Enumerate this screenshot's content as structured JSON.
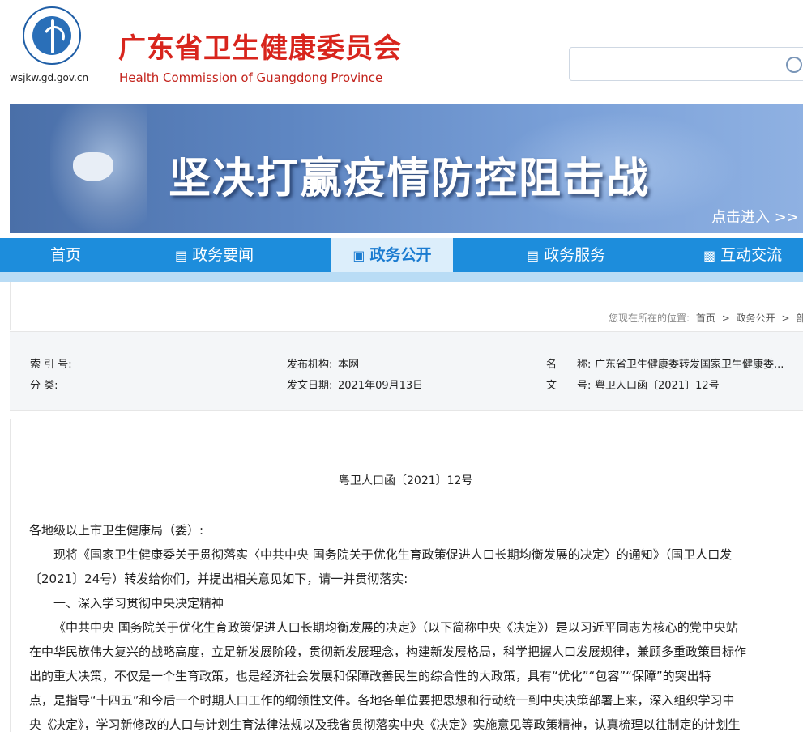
{
  "header": {
    "domain": "wsjkw.gd.gov.cn",
    "title": "广东省卫生健康委员会",
    "subtitle": "Health Commission of Guangdong Province",
    "search_placeholder": ""
  },
  "banner": {
    "title": "坚决打赢疫情防控阻击战",
    "enter_link": "点击进入 >>"
  },
  "nav": {
    "items": [
      {
        "label": "首页",
        "icon": ""
      },
      {
        "label": "政务要闻",
        "icon": "list-icon"
      },
      {
        "label": "政务公开",
        "icon": "book-icon"
      },
      {
        "label": "政务服务",
        "icon": "document-icon"
      },
      {
        "label": "互动交流",
        "icon": "chat-icon"
      }
    ],
    "active": "政务公开"
  },
  "breadcrumb": {
    "prefix": "您现在所在的位置:",
    "items": [
      "首页",
      ">",
      "政务公开",
      ">",
      "部门"
    ]
  },
  "meta": {
    "index_label": "索 引 号:",
    "index_value": "",
    "category_label": "分 类:",
    "category_value": "",
    "publisher_label": "发布机构:",
    "publisher_value": "本网",
    "date_label": "发文日期:",
    "date_value": "2021年09月13日",
    "name_label_1": "名",
    "name_label_2": "称:",
    "name_value": "广东省卫生健康委转发国家卫生健康委...",
    "doc_label_1": "文",
    "doc_label_2": "号:",
    "doc_value": "粤卫人口函〔2021〕12号"
  },
  "document": {
    "number": "粤卫人口函〔2021〕12号",
    "paragraphs": [
      "各地级以上市卫生健康局（委）:",
      "现将《国家卫生健康委关于贯彻落实〈中共中央 国务院关于优化生育政策促进人口长期均衡发展的决定〉的通知》（国卫人口发",
      "〔2021〕24号）转发给你们，并提出相关意见如下，请一并贯彻落实:",
      "一、深入学习贯彻中央决定精神",
      "《中共中央 国务院关于优化生育政策促进人口长期均衡发展的决定》（以下简称中央《决定》）是以习近平同志为核心的党中央站",
      "在中华民族伟大复兴的战略高度，立足新发展阶段，贯彻新发展理念，构建新发展格局，科学把握人口发展规律，兼顾多重政策目标作",
      "出的重大决策，不仅是一个生育政策，也是经济社会发展和保障改善民生的综合性的大政策，具有“优化”“包容”“保障”的突出特",
      "点，是指导“十四五”和今后一个时期人口工作的纲领性文件。各地各单位要把思想和行动统一到中央决策部署上来，深入组织学习中",
      "央《决定》，学习新修改的人口与计划生育法律法规以及我省贯彻落实中央《决定》实施意见等政策精神，认真梳理以往制定的计划生"
    ]
  }
}
